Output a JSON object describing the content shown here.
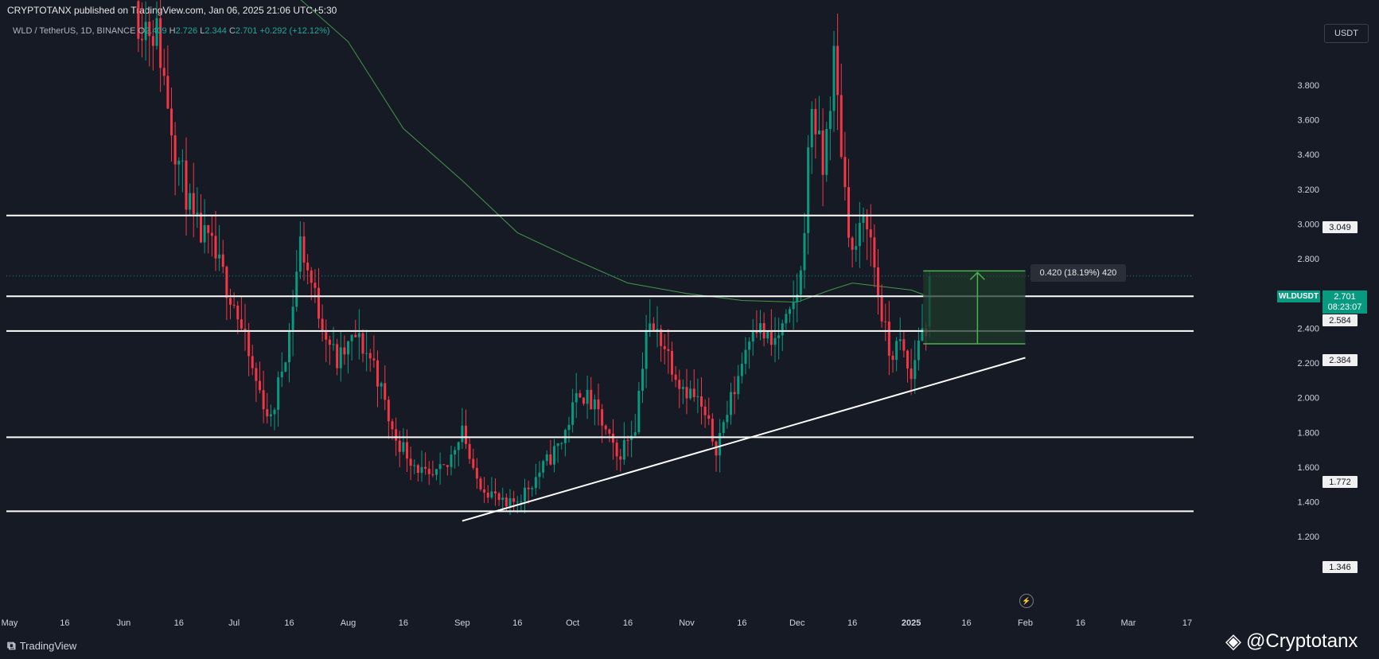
{
  "header": {
    "published": "CRYPTOTANX published on TradingView.com, Jan 06, 2025 21:06 UTC+5:30"
  },
  "legend": {
    "symbol": "WLD / TetherUS, 1D, BINANCE",
    "o_label": "O",
    "o_value": "2.409",
    "h_label": "H",
    "h_value": "2.726",
    "l_label": "L",
    "l_value": "2.344",
    "c_label": "C",
    "c_value": "2.701",
    "change": "+0.292 (+12.12%)"
  },
  "unit_button": "USDT",
  "measure": {
    "label": "0.420 (18.19%) 420"
  },
  "price_tags": {
    "symbol": "WLDUSDT",
    "last": "2.701",
    "countdown": "08:23:07",
    "levels": [
      "3.049",
      "2.584",
      "2.384",
      "1.772",
      "1.346"
    ]
  },
  "footer": {
    "logo_text": "TradingView",
    "watermark": "@Cryptotanx",
    "logo_icon": "tradingview-icon",
    "watermark_icon": "binance-icon",
    "clock_icon": "clock-icon"
  },
  "colors": {
    "background": "#161a25",
    "up": "#089981",
    "down": "#f23645",
    "ma": "#4caf50",
    "levels": "#ffffff",
    "measure_fill": "#1e3a2a",
    "measure_stroke": "#4caf50"
  },
  "chart_data": {
    "type": "candlestick",
    "x_ticks": [
      "May",
      "16",
      "Jun",
      "16",
      "Jul",
      "16",
      "Aug",
      "16",
      "Sep",
      "16",
      "Oct",
      "16",
      "Nov",
      "16",
      "Dec",
      "16",
      "2025",
      "16",
      "Feb",
      "16",
      "Mar",
      "17"
    ],
    "y_ticks": [
      1.2,
      1.4,
      1.6,
      1.8,
      2.0,
      2.2,
      2.4,
      2.6,
      2.8,
      3.0,
      3.2,
      3.4,
      3.6,
      3.8
    ],
    "ylim": [
      1.1,
      4.18
    ],
    "horizontal_levels": [
      3.049,
      2.584,
      2.384,
      1.772,
      1.346
    ],
    "trendline": {
      "start": [
        "2024-09-01",
        1.29
      ],
      "end": [
        "2025-02-01",
        2.23
      ]
    },
    "last_price": 2.701,
    "measure": {
      "from_date": "2025-01-06",
      "to_date": "2025-02-01",
      "low": 2.31,
      "high": 2.73,
      "arrow_date": "2025-01-19"
    },
    "ma_curve": [
      [
        "2024-07-16",
        4.35
      ],
      [
        "2024-08-01",
        4.05
      ],
      [
        "2024-08-16",
        3.55
      ],
      [
        "2024-09-01",
        3.25
      ],
      [
        "2024-09-16",
        2.95
      ],
      [
        "2024-10-01",
        2.8
      ],
      [
        "2024-10-16",
        2.66
      ],
      [
        "2024-11-01",
        2.6
      ],
      [
        "2024-11-16",
        2.56
      ],
      [
        "2024-12-01",
        2.55
      ],
      [
        "2024-12-10",
        2.62
      ],
      [
        "2024-12-16",
        2.66
      ],
      [
        "2025-01-01",
        2.62
      ],
      [
        "2025-01-06",
        2.58
      ]
    ],
    "anchors": [
      [
        "2024-06-05",
        4.2
      ],
      [
        "2024-06-10",
        4.1
      ],
      [
        "2024-06-15",
        3.45
      ],
      [
        "2024-06-20",
        3.0
      ],
      [
        "2024-06-25",
        2.85
      ],
      [
        "2024-07-01",
        2.55
      ],
      [
        "2024-07-06",
        2.15
      ],
      [
        "2024-07-11",
        1.86
      ],
      [
        "2024-07-16",
        2.38
      ],
      [
        "2024-07-19",
        2.9
      ],
      [
        "2024-07-24",
        2.5
      ],
      [
        "2024-07-29",
        2.2
      ],
      [
        "2024-08-03",
        2.35
      ],
      [
        "2024-08-08",
        2.2
      ],
      [
        "2024-08-13",
        1.8
      ],
      [
        "2024-08-18",
        1.65
      ],
      [
        "2024-08-23",
        1.52
      ],
      [
        "2024-08-28",
        1.6
      ],
      [
        "2024-09-01",
        1.85
      ],
      [
        "2024-09-04",
        1.55
      ],
      [
        "2024-09-09",
        1.45
      ],
      [
        "2024-09-13",
        1.36
      ],
      [
        "2024-09-18",
        1.46
      ],
      [
        "2024-09-23",
        1.6
      ],
      [
        "2024-09-28",
        1.75
      ],
      [
        "2024-10-03",
        2.05
      ],
      [
        "2024-10-08",
        1.9
      ],
      [
        "2024-10-13",
        1.65
      ],
      [
        "2024-10-18",
        1.85
      ],
      [
        "2024-10-21",
        2.4
      ],
      [
        "2024-10-25",
        2.35
      ],
      [
        "2024-10-30",
        2.1
      ],
      [
        "2024-11-04",
        1.98
      ],
      [
        "2024-11-09",
        1.72
      ],
      [
        "2024-11-14",
        2.05
      ],
      [
        "2024-11-19",
        2.45
      ],
      [
        "2024-11-24",
        2.3
      ],
      [
        "2024-11-29",
        2.45
      ],
      [
        "2024-12-02",
        2.7
      ],
      [
        "2024-12-05",
        3.7
      ],
      [
        "2024-12-08",
        3.3
      ],
      [
        "2024-12-11",
        3.95
      ],
      [
        "2024-12-14",
        3.2
      ],
      [
        "2024-12-16",
        2.82
      ],
      [
        "2024-12-20",
        3.05
      ],
      [
        "2024-12-23",
        2.6
      ],
      [
        "2024-12-26",
        2.25
      ],
      [
        "2024-12-29",
        2.3
      ],
      [
        "2025-01-01",
        2.1
      ],
      [
        "2025-01-03",
        2.35
      ],
      [
        "2025-01-05",
        2.409
      ],
      [
        "2025-01-06",
        2.701
      ]
    ],
    "last_bar": {
      "date": "2025-01-06",
      "open": 2.409,
      "high": 2.726,
      "low": 2.344,
      "close": 2.701
    }
  }
}
